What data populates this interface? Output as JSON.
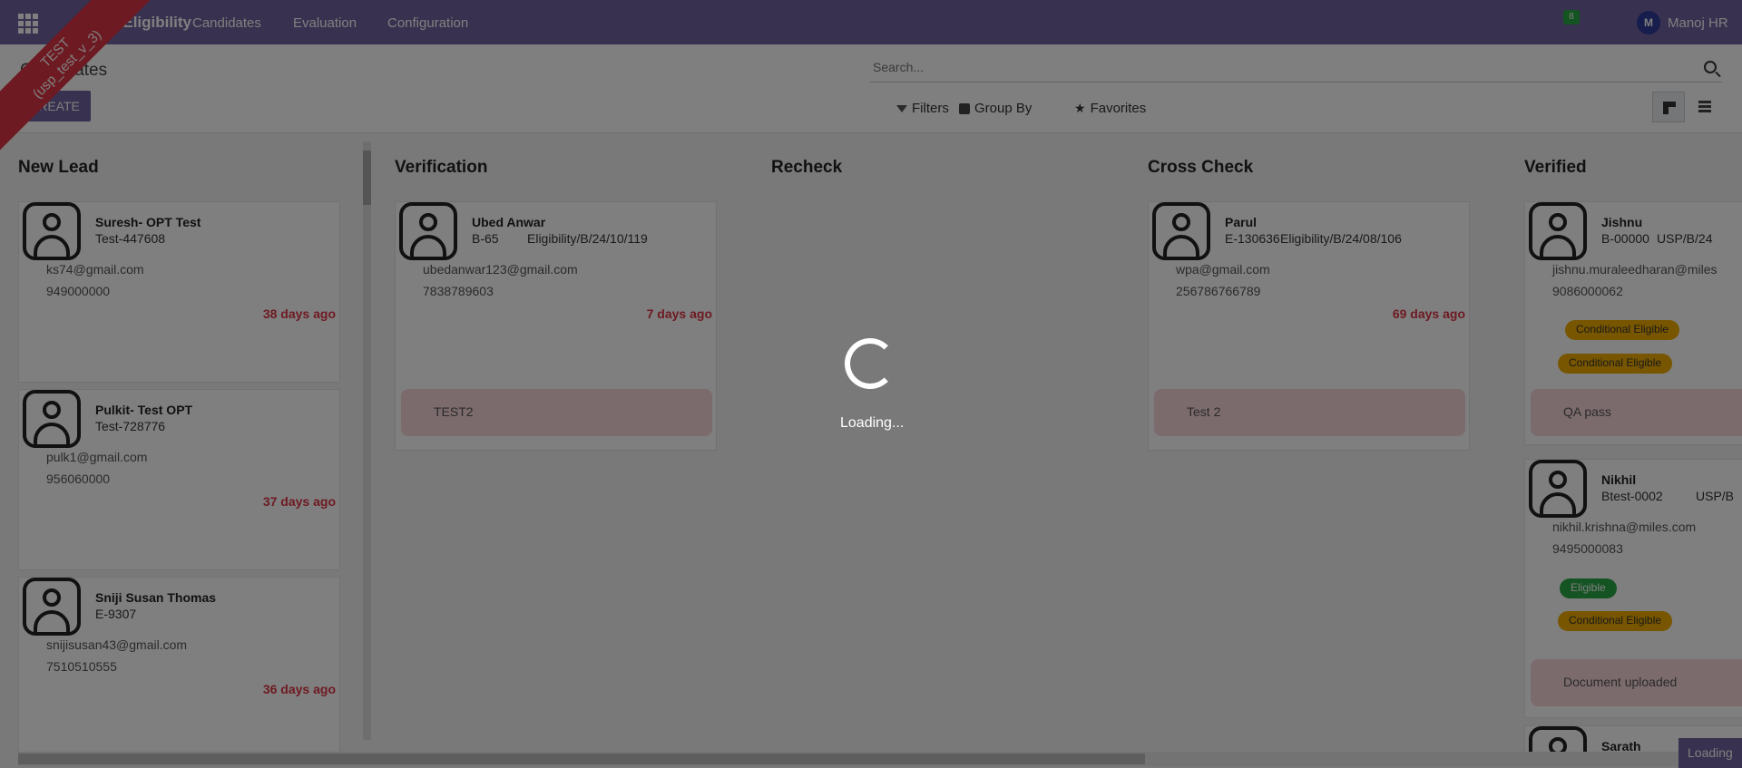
{
  "ribbon": {
    "line1": "TEST",
    "line2": "(usp_test_v_3)"
  },
  "topbar": {
    "app_name": "USP Eligibility",
    "nav": [
      "Candidates",
      "Evaluation",
      "Configuration"
    ],
    "notification_count": "8",
    "user_initial": "M",
    "user_name": "Manoj HR"
  },
  "control_panel": {
    "breadcrumb": "Candidates",
    "search_placeholder": "Search...",
    "create_label": "CREATE",
    "filters_label": "Filters",
    "groupby_label": "Group By",
    "favorites_label": "Favorites"
  },
  "columns": [
    {
      "title": "New Lead",
      "cards": [
        {
          "name": "Suresh- OPT Test",
          "ref": "Test-447608",
          "email": "ks74@gmail.com",
          "phone": "949000000",
          "days": "38 days ago"
        },
        {
          "name": "Pulkit- Test OPT",
          "ref": "Test-728776",
          "email": "pulk1@gmail.com",
          "phone": "956060000",
          "days": "37 days ago"
        },
        {
          "name": "Sniji Susan Thomas",
          "ref": "E-9307",
          "email": "snijisusan43@gmail.com",
          "phone": "7510510555",
          "days": "36 days ago"
        }
      ]
    },
    {
      "title": "Verification",
      "cards": [
        {
          "name": "Ubed Anwar",
          "ref": "B-65",
          "ref2": "Eligibility/B/24/10/119",
          "email": "ubedanwar123@gmail.com",
          "phone": "7838789603",
          "days": "7 days ago",
          "note": "TEST2"
        }
      ]
    },
    {
      "title": "Recheck",
      "cards": []
    },
    {
      "title": "Cross Check",
      "cards": [
        {
          "name": "Parul",
          "ref": "E-130636",
          "ref2": "Eligibility/B/24/08/106",
          "email": "wpa@gmail.com",
          "phone": "256786766789",
          "days": "69 days ago",
          "note": "Test 2"
        }
      ]
    },
    {
      "title": "Verified",
      "cards": [
        {
          "name": "Jishnu",
          "ref": "B-00000",
          "ref2": "USP/B/24",
          "email": "jishnu.muraleedharan@miles",
          "phone": "9086000062",
          "tags": [
            "Conditional Eligible",
            "Conditional Eligible"
          ],
          "note": "QA pass"
        },
        {
          "name": "Nikhil",
          "ref": "Btest-0002",
          "ref2": "USP/B",
          "email": "nikhil.krishna@miles.com",
          "phone": "9495000083",
          "tags": [
            "Eligible",
            "Conditional Eligible"
          ],
          "note": "Document uploaded"
        },
        {
          "name": "Sarath",
          "ref": "",
          "email": "",
          "phone": ""
        }
      ]
    }
  ],
  "loading": {
    "text": "Loading...",
    "chip": "Loading"
  }
}
